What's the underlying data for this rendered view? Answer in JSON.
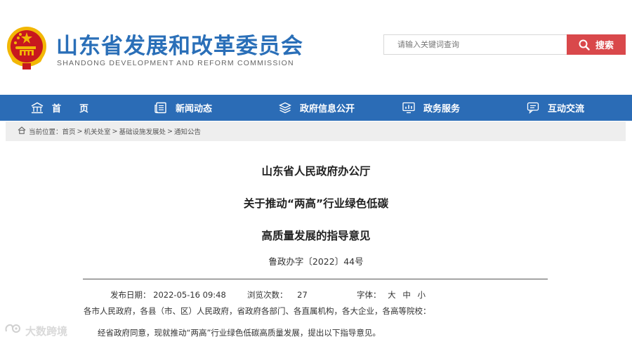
{
  "header": {
    "site_title": "山东省发展和改革委员会",
    "site_subtitle": "SHANDONG DEVELOPMENT AND REFORM COMMISSION",
    "search": {
      "placeholder": "请输入关键词查询",
      "button_label": "搜索"
    }
  },
  "nav": {
    "items": [
      {
        "label": "首　　页",
        "icon": "home-icon"
      },
      {
        "label": "新闻动态",
        "icon": "news-icon"
      },
      {
        "label": "政府信息公开",
        "icon": "layers-icon"
      },
      {
        "label": "政务服务",
        "icon": "monitor-chart-icon"
      },
      {
        "label": "互动交流",
        "icon": "chat-icon"
      }
    ]
  },
  "breadcrumb": {
    "prefix": "当前位置：",
    "items": [
      "首页",
      "机关处室",
      "基础设施发展处",
      "通知公告"
    ],
    "separator": ">"
  },
  "article": {
    "title_lines": [
      "山东省人民政府办公厅",
      "关于推动“两高”行业绿色低碳",
      "高质量发展的指导意见"
    ],
    "doc_number": "鲁政办字〔2022〕44号",
    "publish_label": "发布日期：",
    "publish_date": "2022-05-16 09:48",
    "views_label": "浏览次数：",
    "views": "27",
    "font_label": "字体：",
    "font_options": [
      "大",
      "中",
      "小"
    ],
    "recipients": "各市人民政府，各县（市、区）人民政府，省政府各部门、各直属机构，各大企业，各高等院校：",
    "body_first_line": "经省政府同意，现就推动“两高”行业绿色低碳高质量发展，提出以下指导意见。"
  },
  "watermark": {
    "text": "大数跨境"
  },
  "colors": {
    "brand_blue": "#2b6cb6",
    "title_blue": "#2a6fb8",
    "search_red": "#d9484b",
    "breadcrumb_bg": "#eeeeee",
    "emblem_red": "#c8181e",
    "emblem_gold": "#f2b705"
  }
}
